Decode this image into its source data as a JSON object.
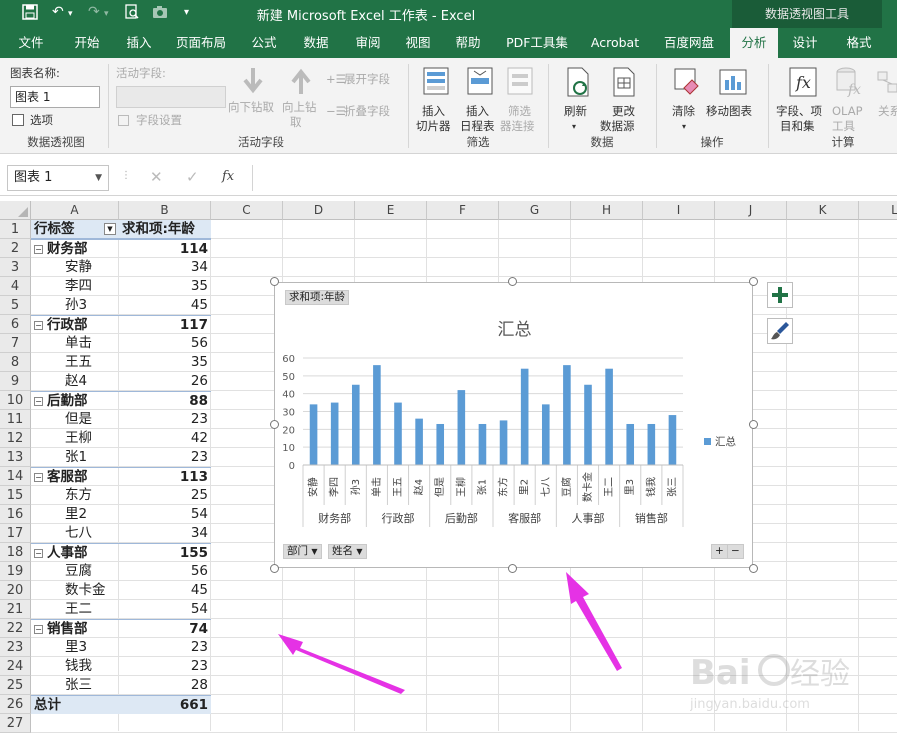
{
  "app": {
    "title": "新建 Microsoft Excel 工作表 - Excel",
    "context_tab_group": "数据透视图工具"
  },
  "tabs": [
    "文件",
    "开始",
    "插入",
    "页面布局",
    "公式",
    "数据",
    "审阅",
    "视图",
    "帮助",
    "PDF工具集",
    "Acrobat",
    "百度网盘",
    "分析",
    "设计",
    "格式"
  ],
  "active_tab": "分析",
  "ribbon": {
    "pivotchart": {
      "name_label": "图表名称:",
      "name_value": "图表 1",
      "options_label": "选项",
      "group_label": "数据透视图"
    },
    "active_field": {
      "label": "活动字段:",
      "field_settings": "字段设置",
      "drill_down": "向下钻取",
      "drill_up_1": "向上钻",
      "drill_up_2": "取",
      "expand": "展开字段",
      "collapse": "折叠字段",
      "group_label": "活动字段"
    },
    "filter": {
      "slicer_1": "插入",
      "slicer_2": "切片器",
      "timeline_1": "插入",
      "timeline_2": "日程表",
      "connections_1": "筛选",
      "connections_2": "器连接",
      "group_label": "筛选"
    },
    "data": {
      "refresh": "刷新",
      "change_1": "更改",
      "change_2": "数据源",
      "group_label": "数据"
    },
    "actions": {
      "clear": "清除",
      "move": "移动图表",
      "group_label": "操作"
    },
    "calc": {
      "fields_1": "字段、项",
      "fields_2": "目和集",
      "olap_1": "OLAP",
      "olap_2": "工具",
      "rel": "关系",
      "group_label": "计算"
    }
  },
  "formula_bar": {
    "name_box": "图表 1",
    "fx": "fx"
  },
  "columns": [
    "A",
    "B",
    "C",
    "D",
    "E",
    "F",
    "G",
    "H",
    "I",
    "J",
    "K",
    "L"
  ],
  "rows": [
    "1",
    "2",
    "3",
    "4",
    "5",
    "6",
    "7",
    "8",
    "9",
    "10",
    "11",
    "12",
    "13",
    "14",
    "15",
    "16",
    "17",
    "18",
    "19",
    "20",
    "21",
    "22",
    "23",
    "24",
    "25",
    "26",
    "27"
  ],
  "pivot": {
    "header_label": "行标签",
    "header_value": "求和项:年龄",
    "rows": [
      {
        "label": "财务部",
        "value": "114",
        "group": true
      },
      {
        "label": "安静",
        "value": "34"
      },
      {
        "label": "李四",
        "value": "35"
      },
      {
        "label": "孙3",
        "value": "45"
      },
      {
        "label": "行政部",
        "value": "117",
        "group": true
      },
      {
        "label": "单击",
        "value": "56"
      },
      {
        "label": "王五",
        "value": "35"
      },
      {
        "label": "赵4",
        "value": "26"
      },
      {
        "label": "后勤部",
        "value": "88",
        "group": true
      },
      {
        "label": "但是",
        "value": "23"
      },
      {
        "label": "王柳",
        "value": "42"
      },
      {
        "label": "张1",
        "value": "23"
      },
      {
        "label": "客服部",
        "value": "113",
        "group": true
      },
      {
        "label": "东方",
        "value": "25"
      },
      {
        "label": "里2",
        "value": "54"
      },
      {
        "label": "七八",
        "value": "34"
      },
      {
        "label": "人事部",
        "value": "155",
        "group": true
      },
      {
        "label": "豆腐",
        "value": "56"
      },
      {
        "label": "数卡金",
        "value": "45"
      },
      {
        "label": "王二",
        "value": "54"
      },
      {
        "label": "销售部",
        "value": "74",
        "group": true
      },
      {
        "label": "里3",
        "value": "23"
      },
      {
        "label": "钱我",
        "value": "23"
      },
      {
        "label": "张三",
        "value": "28"
      }
    ],
    "total_label": "总计",
    "total_value": "661"
  },
  "chart_data": {
    "type": "bar",
    "title": "汇总",
    "value_field_button": "求和项:年龄",
    "categories": [
      "安静",
      "李四",
      "孙3",
      "单击",
      "王五",
      "赵4",
      "但是",
      "王柳",
      "张1",
      "东方",
      "里2",
      "七八",
      "豆腐",
      "数卡金",
      "王二",
      "里3",
      "钱我",
      "张三"
    ],
    "groups": [
      {
        "name": "财务部",
        "count": 3
      },
      {
        "name": "行政部",
        "count": 3
      },
      {
        "name": "后勤部",
        "count": 3
      },
      {
        "name": "客服部",
        "count": 3
      },
      {
        "name": "人事部",
        "count": 3
      },
      {
        "name": "销售部",
        "count": 3
      }
    ],
    "series": [
      {
        "name": "汇总",
        "values": [
          34,
          35,
          45,
          56,
          35,
          26,
          23,
          42,
          23,
          25,
          54,
          34,
          56,
          45,
          54,
          23,
          23,
          28
        ],
        "color": "#5b9bd5"
      }
    ],
    "ylim": [
      0,
      60
    ],
    "yticks": [
      "0",
      "10",
      "20",
      "30",
      "40",
      "50",
      "60"
    ],
    "legend_position": "right",
    "axis_buttons": [
      "部门",
      "姓名"
    ],
    "grid": true
  },
  "colors": {
    "excel_green": "#217346",
    "bar": "#5b9bd5",
    "arrow": "#e532e5"
  }
}
